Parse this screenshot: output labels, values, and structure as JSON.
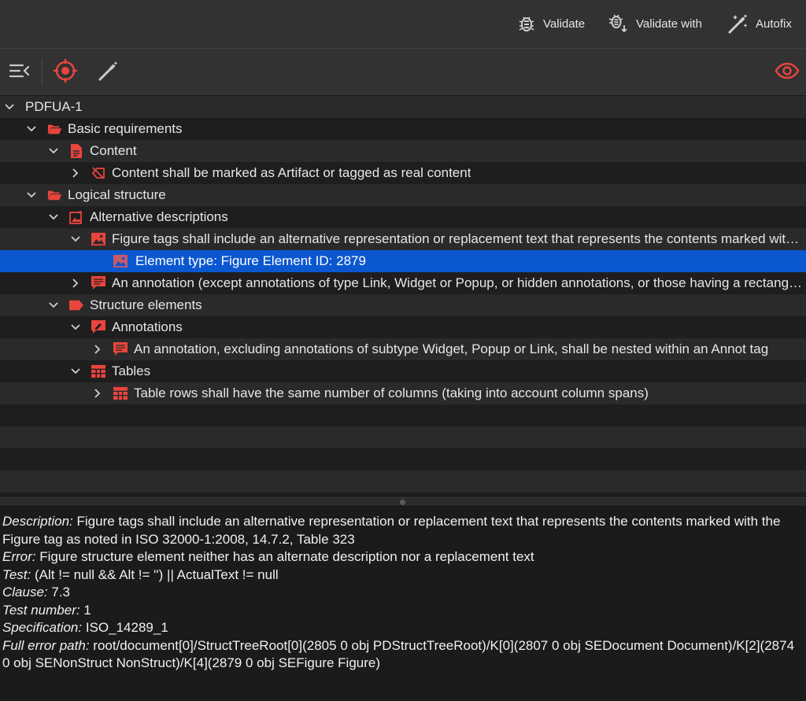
{
  "topbar": {
    "validate_label": "Validate",
    "validate_with_label": "Validate with",
    "autofix_label": "Autofix"
  },
  "colors": {
    "accent_red": "#e8453c",
    "selection_blue": "#0b57d0"
  },
  "tree": {
    "root": "PDFUA-1",
    "basic_requirements": "Basic requirements",
    "content": "Content",
    "content_rule": "Content shall be marked as Artifact or tagged as real content",
    "logical_structure": "Logical structure",
    "alt_descriptions": "Alternative descriptions",
    "figure_rule": "Figure tags shall include an alternative representation or replacement text that represents the contents marked with the Figure tag as noted in ISO 32000-1:2008, 14.7.2, Table 323",
    "figure_element": "Element type: Figure Element ID:  2879",
    "annotation_rule": "An annotation (except annotations of type Link, Widget or Popup, or hidden annotations, or those having a rectangle that is outside the CropBox) shall have an alternate description",
    "structure_elements": "Structure elements",
    "annotations": "Annotations",
    "annotation_nesting_rule": "An annotation, excluding annotations of subtype Widget, Popup or Link, shall be nested within an Annot tag",
    "tables": "Tables",
    "table_rule": "Table rows shall have the same number of columns (taking into account column spans)"
  },
  "details": {
    "description_label": "Description:",
    "description_text": "Figure tags shall include an alternative representation or replacement text that represents the contents marked with the Figure tag as noted in ISO 32000-1:2008, 14.7.2, Table 323",
    "error_label": "Error:",
    "error_text": "Figure structure element neither has an alternate description nor a replacement text",
    "test_label": "Test:",
    "test_text": "(Alt != null && Alt != '') || ActualText != null",
    "clause_label": "Clause:",
    "clause_text": "7.3",
    "test_number_label": "Test number:",
    "test_number_text": "1",
    "specification_label": "Specification:",
    "specification_text": "ISO_14289_1",
    "full_path_label": "Full error path:",
    "full_path_text": "root/document[0]/StructTreeRoot[0](2805 0 obj PDStructTreeRoot)/K[0](2807 0 obj SEDocument Document)/K[2](2874 0 obj SENonStruct NonStruct)/K[4](2879 0 obj SEFigure Figure)"
  }
}
